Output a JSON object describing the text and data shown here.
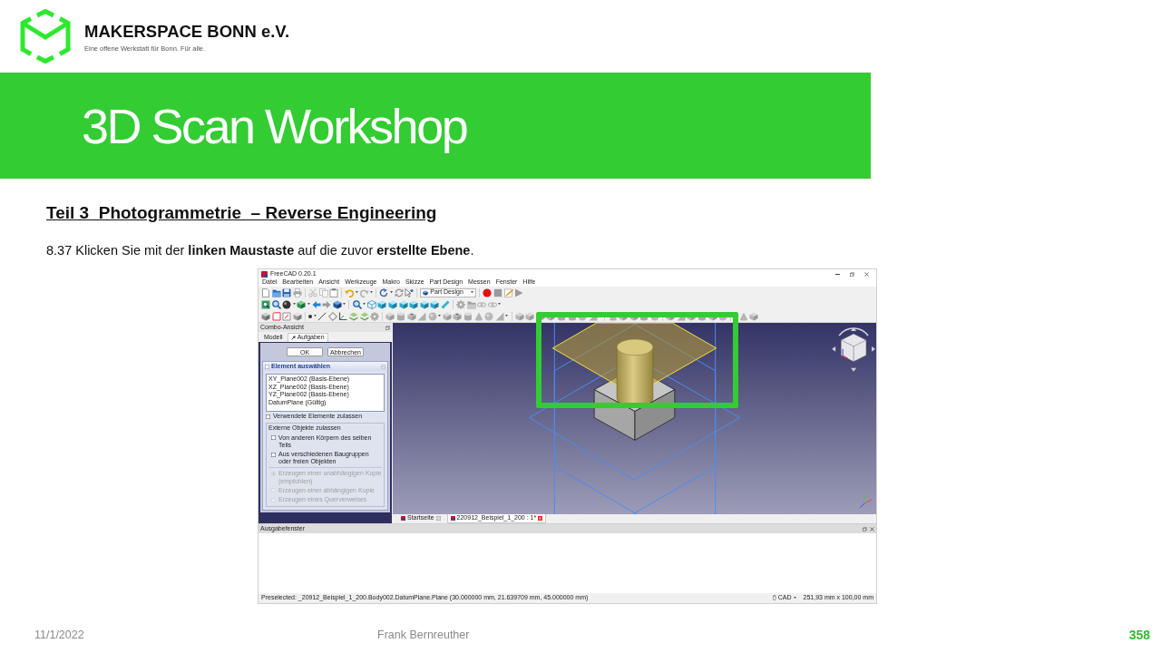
{
  "logo": {
    "name": "MAKERSPACE BONN e.V.",
    "tagline": "Eine offene Werkstatt für Bonn. Für alle."
  },
  "banner": {
    "title": "3D Scan Workshop"
  },
  "heading": "Teil 3  Photogrammetrie  – Reverse Engineering",
  "instruction": "8.37 Klicken Sie mit der **linken Maustaste** auf die zuvor **erstellte Ebene**.",
  "app_window": {
    "title": "FreeCAD 0.20.1",
    "menu": [
      "Datei",
      "Bearbeiten",
      "Ansicht",
      "Werkzeuge",
      "Makro",
      "Skizze",
      "Part Design",
      "Messen",
      "Fenster",
      "Hilfe"
    ],
    "workbench": "Part Design",
    "combo_view": {
      "title": "Combo-Ansicht",
      "tabs": [
        {
          "label": "Modell",
          "selected": false
        },
        {
          "label": "Aufgaben",
          "selected": true
        }
      ],
      "buttons": [
        "OK",
        "Abbrechen"
      ],
      "section": {
        "title": "Element auswählen",
        "items": [
          "XY_Plane002 (Basis-Ebene)",
          "XZ_Plane002 (Basis-Ebene)",
          "YZ_Plane002 (Basis-Ebene)",
          "DatumPlane (Gültig)"
        ],
        "options": [
          {
            "kind": "checkbox",
            "label": "Verwendete Elemente zulassen",
            "checked": false,
            "disabled": false
          }
        ],
        "group": {
          "title": "Externe Objekte zulassen",
          "options": [
            {
              "kind": "checkbox",
              "label": "Von anderen Körpern des selben Teils",
              "checked": false,
              "disabled": false
            },
            {
              "kind": "checkbox",
              "label": "Aus verschiedenen Baugruppen oder freien Objekten",
              "checked": false,
              "disabled": false
            },
            {
              "kind": "radio",
              "label": "Erzeugen einer unabhängigen Kopie (empfohlen)",
              "checked": true,
              "disabled": true
            },
            {
              "kind": "radio",
              "label": "Erzeugen einer abhängigen Kopie",
              "checked": false,
              "disabled": true
            },
            {
              "kind": "radio",
              "label": "Erzeugen eines Querverweises",
              "checked": false,
              "disabled": true
            }
          ]
        }
      }
    },
    "view_tabs": [
      {
        "label": "Startseite",
        "selected": false
      },
      {
        "label": "220912_Beispiel_1_200 : 1*",
        "selected": true
      }
    ],
    "output_panel": {
      "title": "Ausgabefenster"
    },
    "status_bar": {
      "message": "Preselected: _20912_Beispiel_1_200.Body002.DatumPlane.Plane (30.000000 mm, 21.639709 mm, 45.000000 mm)",
      "navigation": "CAD",
      "dimensions": "251,93 mm x 100,00 mm"
    }
  },
  "footer": {
    "date": "11/1/2022",
    "author": "Frank Bernreuther",
    "page": "358"
  }
}
